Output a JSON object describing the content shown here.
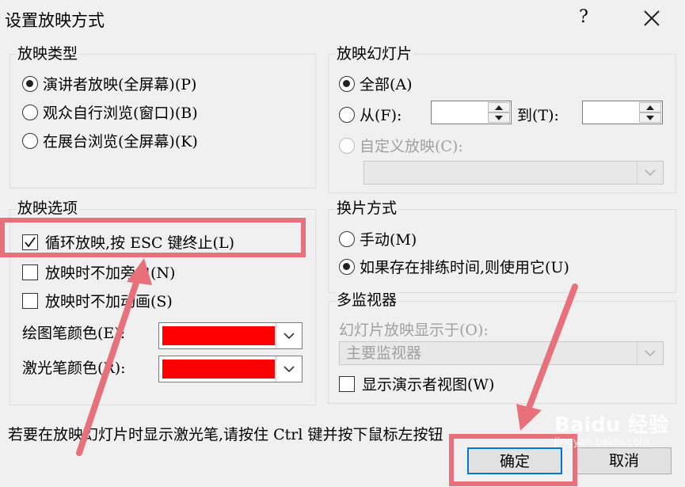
{
  "dialog": {
    "title": "设置放映方式",
    "help_label": "?",
    "close_icon": "close-icon"
  },
  "show_type": {
    "legend": "放映类型",
    "options": [
      {
        "label": "演讲者放映(全屏幕)(P)",
        "selected": true
      },
      {
        "label": "观众自行浏览(窗口)(B)",
        "selected": false
      },
      {
        "label": "在展台浏览(全屏幕)(K)",
        "selected": false
      }
    ]
  },
  "show_slides": {
    "legend": "放映幻灯片",
    "all_label": "全部(A)",
    "from_label": "从(F):",
    "from_value": "",
    "to_label": "到(T):",
    "to_value": "",
    "custom_label": "自定义放映(C):",
    "custom_value": ""
  },
  "show_options": {
    "legend": "放映选项",
    "loop_label": "循环放映,按 ESC 键终止(L)",
    "loop_checked": true,
    "no_narration_label": "放映时不加旁白(N)",
    "no_narration_checked": false,
    "no_animation_label": "放映时不加动画(S)",
    "no_animation_checked": false,
    "pen_color_label": "绘图笔颜色(E):",
    "pen_color": "#ff0000",
    "laser_color_label": "激光笔颜色(R):",
    "laser_color": "#ff0000"
  },
  "advance": {
    "legend": "换片方式",
    "manual_label": "手动(M)",
    "timings_label": "如果存在排练时间,则使用它(U)",
    "selected": "timings"
  },
  "monitors": {
    "legend": "多监视器",
    "display_on_label": "幻灯片放映显示于(O):",
    "display_on_value": "主要监视器",
    "presenter_view_label": "显示演示者视图(W)",
    "presenter_view_checked": false
  },
  "footer_note": "若要在放映幻灯片时显示激光笔,请按住 Ctrl 键并按下鼠标左按钮",
  "buttons": {
    "ok": "确定",
    "cancel": "取消"
  },
  "watermark": {
    "brand": "Baidu",
    "jingyan": "经验",
    "url": "jingyan.baidu.com"
  },
  "colors": {
    "annotation": "#e8707a",
    "accent": "#0078d7"
  }
}
